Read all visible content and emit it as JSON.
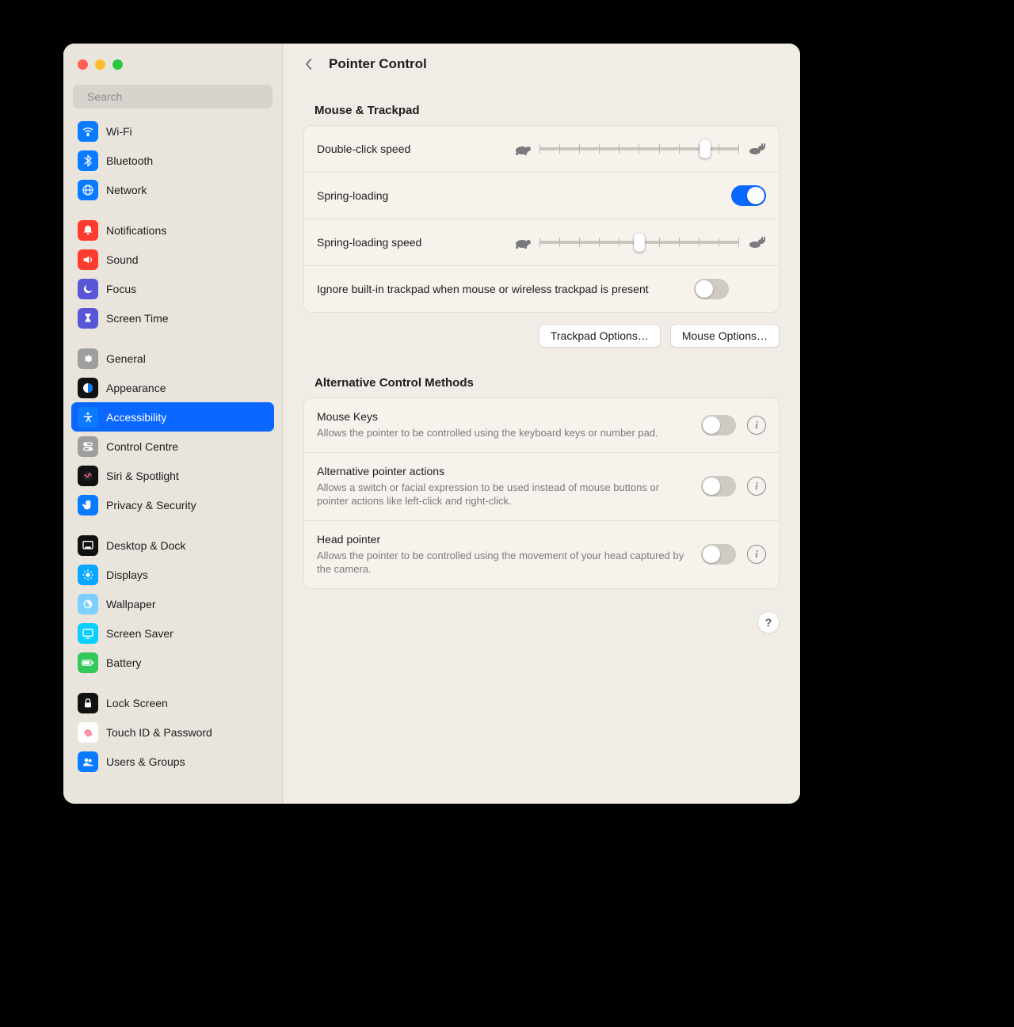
{
  "search": {
    "placeholder": "Search"
  },
  "sidebar": {
    "groups": [
      {
        "items": [
          {
            "label": "Wi-Fi",
            "icon": "wifi",
            "bg": "#0a7aff"
          },
          {
            "label": "Bluetooth",
            "icon": "bluetooth",
            "bg": "#0a7aff"
          },
          {
            "label": "Network",
            "icon": "globe",
            "bg": "#0a7aff"
          }
        ]
      },
      {
        "items": [
          {
            "label": "Notifications",
            "icon": "bell",
            "bg": "#ff3b30"
          },
          {
            "label": "Sound",
            "icon": "speaker",
            "bg": "#ff3b30"
          },
          {
            "label": "Focus",
            "icon": "moon",
            "bg": "#5856d6"
          },
          {
            "label": "Screen Time",
            "icon": "hourglass",
            "bg": "#5856d6"
          }
        ]
      },
      {
        "items": [
          {
            "label": "General",
            "icon": "gear",
            "bg": "#9e9e9e"
          },
          {
            "label": "Appearance",
            "icon": "appearance",
            "bg": "#111"
          },
          {
            "label": "Accessibility",
            "icon": "a11y",
            "bg": "#0a7aff",
            "selected": true
          },
          {
            "label": "Control Centre",
            "icon": "controlcentre",
            "bg": "#9e9e9e"
          },
          {
            "label": "Siri & Spotlight",
            "icon": "siri",
            "bg": "#111"
          },
          {
            "label": "Privacy & Security",
            "icon": "hand",
            "bg": "#0a7aff"
          }
        ]
      },
      {
        "items": [
          {
            "label": "Desktop & Dock",
            "icon": "dock",
            "bg": "#111"
          },
          {
            "label": "Displays",
            "icon": "display",
            "bg": "#0aa7ff"
          },
          {
            "label": "Wallpaper",
            "icon": "wallpaper",
            "bg": "#7ad1ff"
          },
          {
            "label": "Screen Saver",
            "icon": "screensaver",
            "bg": "#0acfff"
          },
          {
            "label": "Battery",
            "icon": "battery",
            "bg": "#34c759"
          }
        ]
      },
      {
        "items": [
          {
            "label": "Lock Screen",
            "icon": "lock",
            "bg": "#111"
          },
          {
            "label": "Touch ID & Password",
            "icon": "touchid",
            "bg": "#fff",
            "fg": "#ff3b66"
          },
          {
            "label": "Users & Groups",
            "icon": "users",
            "bg": "#0a7aff"
          }
        ]
      }
    ]
  },
  "header": {
    "title": "Pointer Control"
  },
  "mouse_trackpad": {
    "title": "Mouse & Trackpad",
    "double_click_speed": {
      "label": "Double-click speed",
      "value_pct": 83
    },
    "spring_loading": {
      "label": "Spring-loading",
      "on": true
    },
    "spring_loading_speed": {
      "label": "Spring-loading speed",
      "value_pct": 50
    },
    "ignore_trackpad": {
      "label": "Ignore built-in trackpad when mouse or wireless trackpad is present",
      "on": false
    },
    "buttons": {
      "trackpad": "Trackpad Options…",
      "mouse": "Mouse Options…"
    }
  },
  "alt_methods": {
    "title": "Alternative Control Methods",
    "items": [
      {
        "label": "Mouse Keys",
        "desc": "Allows the pointer to be controlled using the keyboard keys or number pad.",
        "on": false,
        "info": true
      },
      {
        "label": "Alternative pointer actions",
        "desc": "Allows a switch or facial expression to be used instead of mouse buttons or pointer actions like left-click and right-click.",
        "on": false,
        "info": true
      },
      {
        "label": "Head pointer",
        "desc": "Allows the pointer to be controlled using the movement of your head captured by the camera.",
        "on": false,
        "info": true
      }
    ]
  }
}
